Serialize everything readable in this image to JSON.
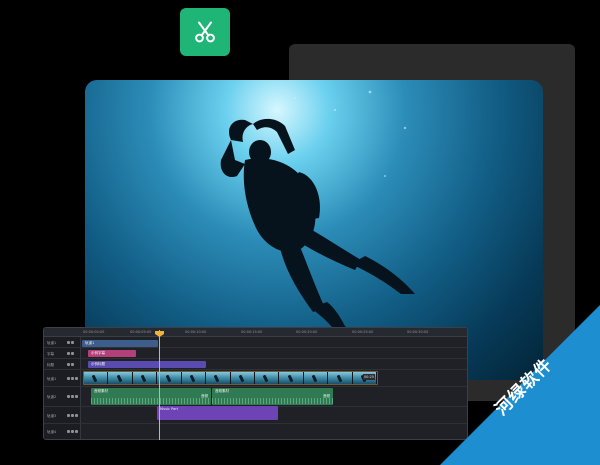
{
  "app": {
    "icon": "scissors-icon",
    "accent_color": "#1fb577"
  },
  "timeline": {
    "ruler_ticks": [
      "00:00:00:00",
      "00:00:05:00",
      "00:00:10:00",
      "00:00:15:00",
      "00:00:20:00",
      "00:00:25:00",
      "00:00:30:00"
    ],
    "tracks": [
      {
        "label": "轨道1"
      },
      {
        "label": "字幕"
      },
      {
        "label": "标题"
      },
      {
        "label": "轨道1"
      },
      {
        "label": "轨道2"
      },
      {
        "label": "轨道3"
      },
      {
        "label": "轨道4"
      }
    ],
    "clips": {
      "sub_clip": "轨道1",
      "subtitle_clip": "示例字幕",
      "title_clip": "示例标题",
      "video_clip_duration": "00:25",
      "audio_clip_1": "音频素材",
      "audio_clip_2": "音频素材",
      "audio_clip_3": "Music Part",
      "audio_clip_1_end": "音频",
      "audio_clip_2_end": "音频"
    },
    "playhead_color": "#f2b13a"
  },
  "watermark": {
    "text": "河绿软件",
    "color": "#1d8fd1"
  }
}
